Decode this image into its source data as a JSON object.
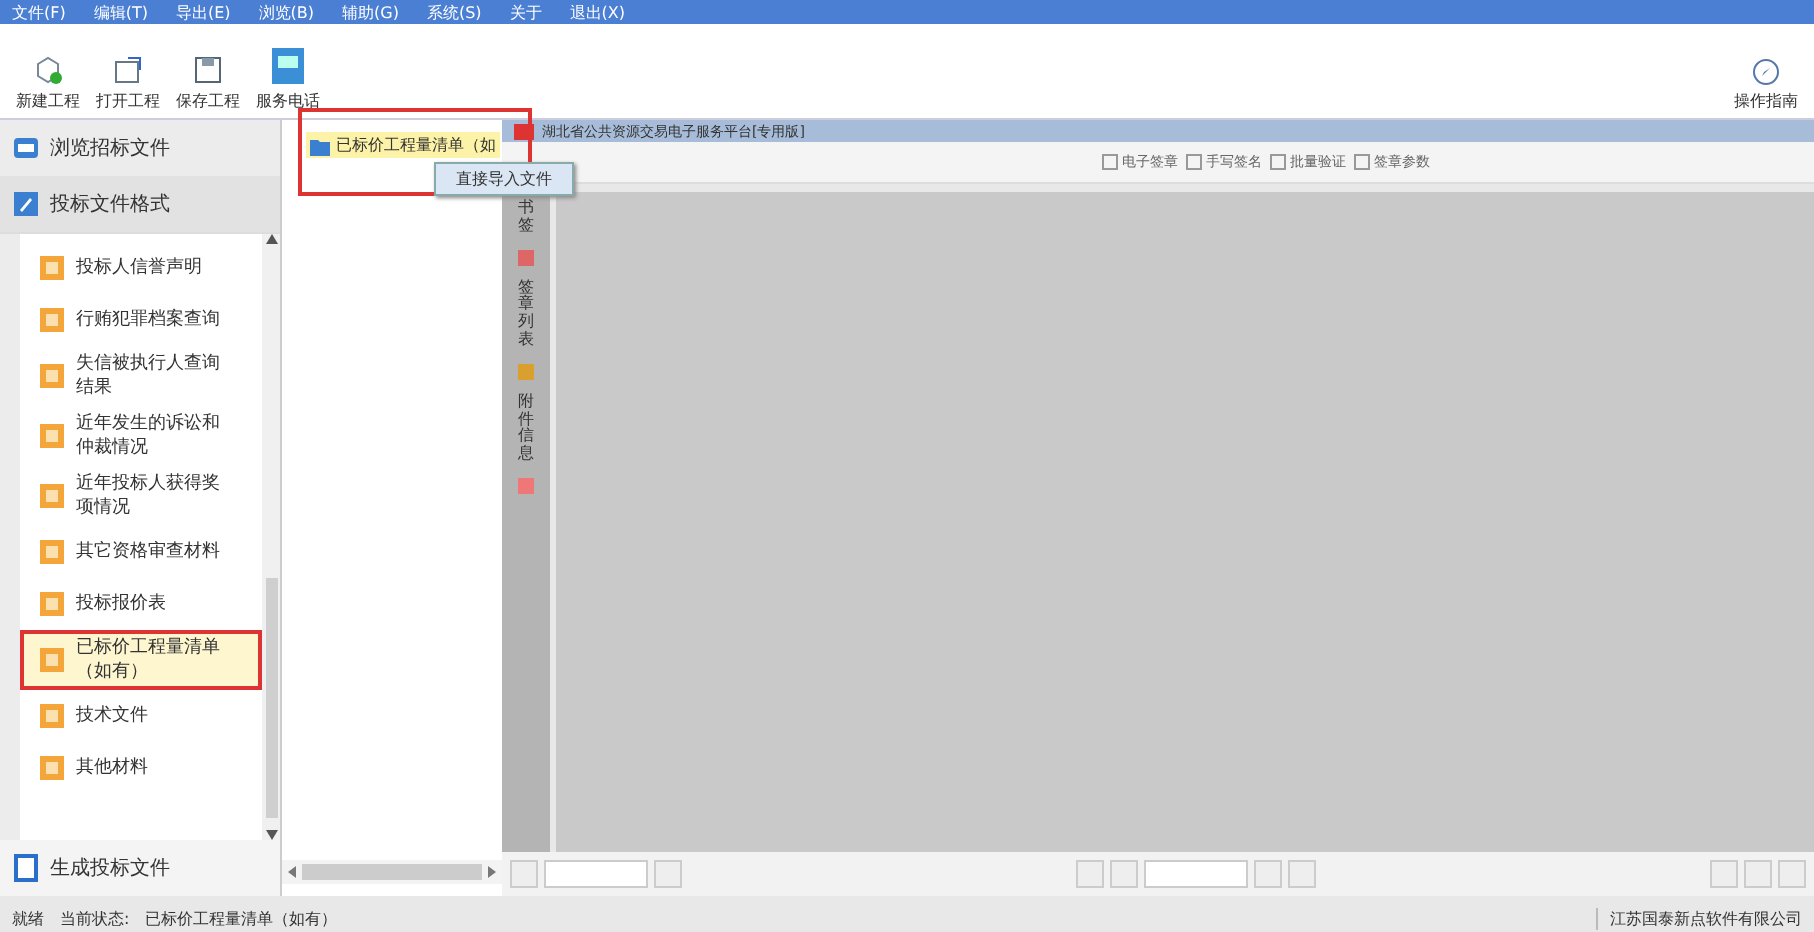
{
  "menu_bar": [
    "文件(F)",
    "编辑(T)",
    "导出(E)",
    "浏览(B)",
    "辅助(G)",
    "系统(S)",
    "关于",
    "退出(X)"
  ],
  "toolbar": [
    {
      "label": "新建工程",
      "kind": "new"
    },
    {
      "label": "打开工程",
      "kind": "open"
    },
    {
      "label": "保存工程",
      "kind": "save"
    },
    {
      "label": "服务电话",
      "kind": "phone"
    }
  ],
  "guide_button": "操作指南",
  "sidebar": {
    "sections": [
      {
        "label": "浏览招标文件",
        "kind": "browse",
        "expanded": false
      },
      {
        "label": "投标文件格式",
        "kind": "format",
        "expanded": true
      }
    ],
    "items": [
      {
        "label": "投标人信誉声明",
        "selected": false
      },
      {
        "label": "行贿犯罪档案查询",
        "selected": false
      },
      {
        "label": "失信被执行人查询结果",
        "selected": false
      },
      {
        "label": "近年发生的诉讼和仲裁情况",
        "selected": false
      },
      {
        "label": "近年投标人获得奖项情况",
        "selected": false
      },
      {
        "label": "其它资格审查材料",
        "selected": false
      },
      {
        "label": "投标报价表",
        "selected": false
      },
      {
        "label": "已标价工程量清单（如有）",
        "selected": true
      },
      {
        "label": "技术文件",
        "selected": false
      },
      {
        "label": "其他材料",
        "selected": false
      }
    ],
    "footer": "生成投标文件"
  },
  "tree": {
    "node": "已标价工程量清单（如",
    "selected": true,
    "annotated": true,
    "context_menu": "直接导入文件"
  },
  "viewer": {
    "tab": "湖北省公共资源交易电子服务平台[专用版]",
    "tools": [
      "电子签章",
      "手写签名",
      "批量验证",
      "签章参数"
    ],
    "side_tabs": [
      "书签",
      "签章列表",
      "附件信息"
    ]
  },
  "status_bar": {
    "state": "就绪",
    "label": "当前状态:",
    "value": "已标价工程量清单（如有）",
    "company": "江苏国泰新点软件有限公司"
  }
}
